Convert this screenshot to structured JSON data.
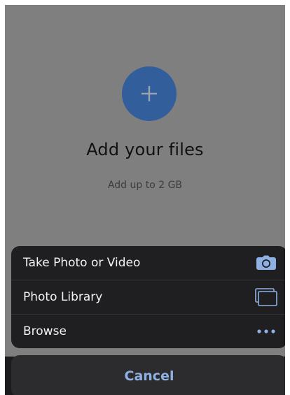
{
  "colors": {
    "backdrop": "#7f7f80",
    "accent": "#325f9c",
    "sheet_bg": "#1f1f21",
    "cancel_text": "#8fb0e3",
    "icon_blue": "#8fb0e3"
  },
  "upload": {
    "add_icon": "plus-icon",
    "title": "Add your files",
    "subtitle": "Add up to 2 GB"
  },
  "action_sheet": {
    "items": [
      {
        "label": "Take Photo or Video",
        "icon": "camera-icon"
      },
      {
        "label": "Photo Library",
        "icon": "photo-library-icon"
      },
      {
        "label": "Browse",
        "icon": "more-dots-icon"
      }
    ],
    "cancel_label": "Cancel"
  }
}
